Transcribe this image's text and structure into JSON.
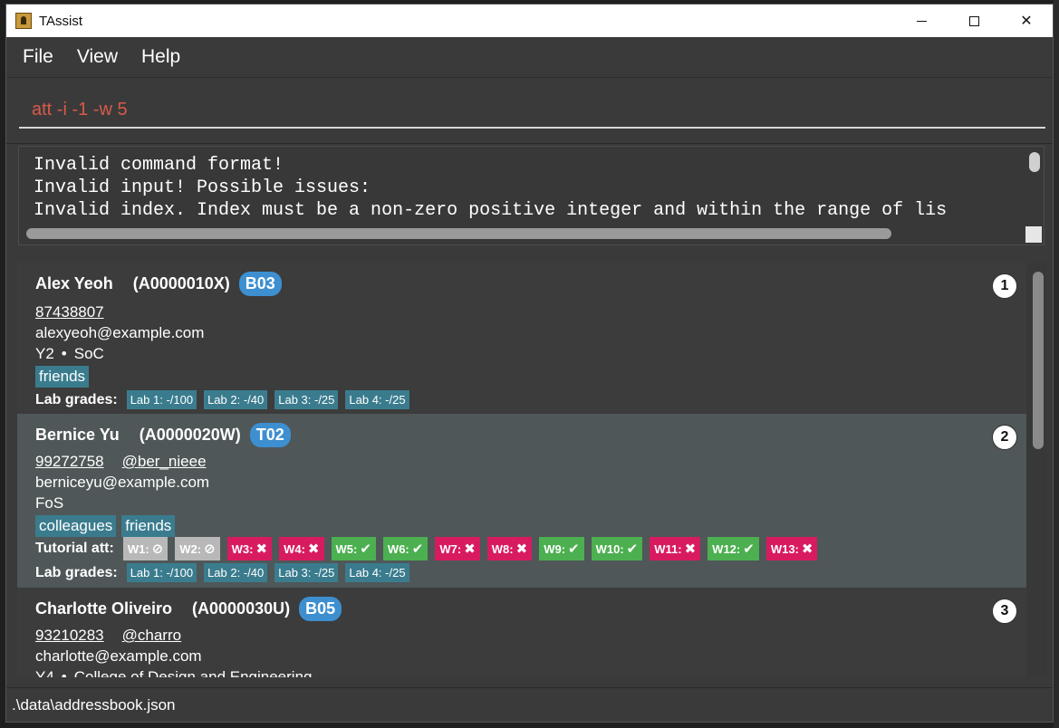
{
  "window": {
    "title": "TAssist",
    "min_label": "",
    "close_label": "✕"
  },
  "menu": [
    "File",
    "View",
    "Help"
  ],
  "command": {
    "value": "att -i -1 -w 5"
  },
  "result": {
    "lines": [
      "Invalid command format!",
      "Invalid input! Possible issues:",
      "Invalid index. Index must be a non-zero positive integer and within the range of lis"
    ]
  },
  "persons": [
    {
      "index": "1",
      "name": "Alex Yeoh",
      "id": "(A0000010X)",
      "group": "B03",
      "phone": "87438807",
      "email": "alexyeoh@example.com",
      "year": "Y2",
      "faculty": "SoC",
      "tags": [
        "friends"
      ],
      "lab_label": "Lab grades:",
      "labs": [
        "Lab 1: -/100",
        "Lab 2: -/40",
        "Lab 3: -/25",
        "Lab 4: -/25"
      ]
    },
    {
      "index": "2",
      "name": "Bernice Yu",
      "id": "(A0000020W)",
      "group": "T02",
      "phone": "99272758",
      "telegram": "@ber_nieee",
      "email": "berniceyu@example.com",
      "faculty": "FoS",
      "tags": [
        "colleagues",
        "friends"
      ],
      "att_label": "Tutorial att:",
      "attendance": [
        {
          "label": "W1:",
          "status": "grey",
          "mark": "⊘"
        },
        {
          "label": "W2:",
          "status": "grey",
          "mark": "⊘"
        },
        {
          "label": "W3:",
          "status": "red",
          "mark": "✖"
        },
        {
          "label": "W4:",
          "status": "red",
          "mark": "✖"
        },
        {
          "label": "W5:",
          "status": "green",
          "mark": "✔"
        },
        {
          "label": "W6:",
          "status": "green",
          "mark": "✔"
        },
        {
          "label": "W7:",
          "status": "red",
          "mark": "✖"
        },
        {
          "label": "W8:",
          "status": "red",
          "mark": "✖"
        },
        {
          "label": "W9:",
          "status": "green",
          "mark": "✔"
        },
        {
          "label": "W10:",
          "status": "green",
          "mark": "✔"
        },
        {
          "label": "W11:",
          "status": "red",
          "mark": "✖"
        },
        {
          "label": "W12:",
          "status": "green",
          "mark": "✔"
        },
        {
          "label": "W13:",
          "status": "red",
          "mark": "✖"
        }
      ],
      "lab_label": "Lab grades:",
      "labs": [
        "Lab 1: -/100",
        "Lab 2: -/40",
        "Lab 3: -/25",
        "Lab 4: -/25"
      ]
    },
    {
      "index": "3",
      "name": "Charlotte Oliveiro",
      "id": "(A0000030U)",
      "group": "B05",
      "phone": "93210283",
      "telegram": "@charro",
      "email": "charlotte@example.com",
      "year": "Y4",
      "faculty": "College of Design and Engineering"
    }
  ],
  "status": {
    "path": ".\\data\\addressbook.json"
  },
  "colors": {
    "accent_group": "#3d8fd0",
    "tag": "#3a7c8e",
    "att_red": "#d81b60",
    "att_green": "#4caf50",
    "att_grey": "#b8b8b8",
    "command_text": "#d85a4a"
  }
}
